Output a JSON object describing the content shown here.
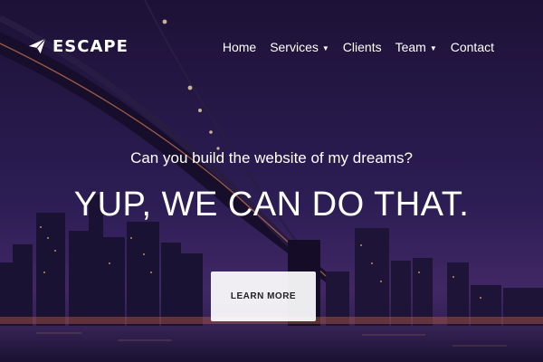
{
  "brand": {
    "name": "ESCAPE",
    "logo_icon": "paper-plane-icon"
  },
  "nav": {
    "items": [
      {
        "label": "Home",
        "dropdown": false
      },
      {
        "label": "Services",
        "dropdown": true
      },
      {
        "label": "Clients",
        "dropdown": false
      },
      {
        "label": "Team",
        "dropdown": true
      },
      {
        "label": "Contact",
        "dropdown": false
      }
    ]
  },
  "hero": {
    "tagline": "Can you build the website of my dreams?",
    "headline": "YUP, WE CAN DO THAT.",
    "cta_label": "LEARN MORE",
    "background": "night-city-bridge-photo"
  },
  "colors": {
    "accent": "#ffffff",
    "overlay": "#2a1d4a"
  }
}
